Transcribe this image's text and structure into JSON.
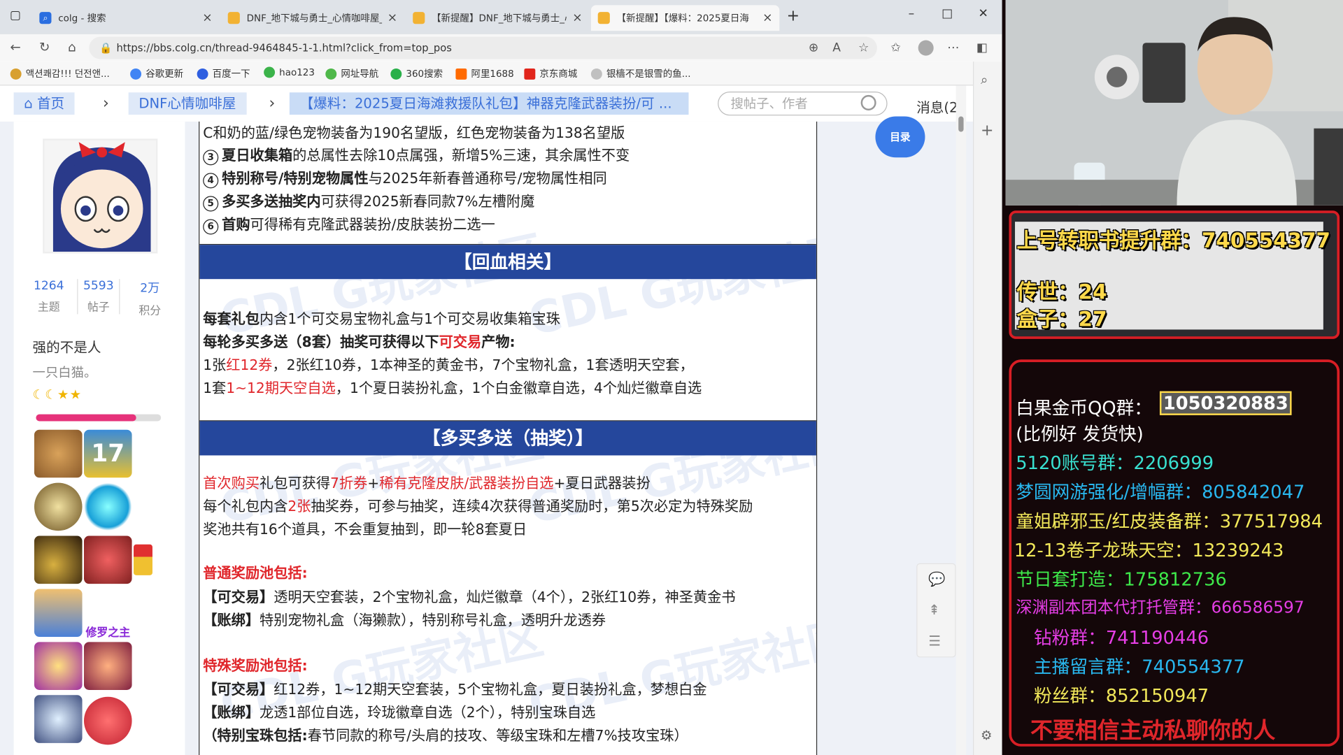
{
  "browser": {
    "tabs": [
      {
        "label": "colg - 搜索",
        "icon": "search-icon"
      },
      {
        "label": "DNF_地下城与勇士_心情咖啡屋_",
        "icon": "colg-favicon"
      },
      {
        "label": "【新提醒】DNF_地下城与勇士_心",
        "icon": "colg-favicon"
      },
      {
        "label": "【新提醒】【爆料：2025夏日海",
        "icon": "colg-favicon"
      }
    ],
    "url": "https://bbs.colg.cn/thread-9464845-1-1.html?click_from=top_pos",
    "bookmarks": [
      "액션쾌감!!! 던전앤...",
      "谷歌更新",
      "百度一下",
      "hao123",
      "网址导航",
      "360搜索",
      "阿里1688",
      "京东商城",
      "银樯不是银雪的鱼..."
    ]
  },
  "forum": {
    "crumbs": [
      "首页",
      "DNF心情咖啡屋",
      "【爆料：2025夏日海滩救援队礼包】神器克隆武器装扮/可 ..."
    ],
    "search_placeholder": "搜帖子、作者",
    "messages": "消息(2",
    "toc": "目录",
    "user": {
      "stats": [
        {
          "num": "1264",
          "label": "主题"
        },
        {
          "num": "5593",
          "label": "帖子"
        },
        {
          "num": "2万",
          "label": "积分"
        }
      ],
      "name": "强的不是人",
      "sign": "一只白猫。",
      "medal_text": "修罗之主",
      "progress": 0.8
    },
    "post": {
      "l1": "C和奶的蓝/绿色宠物装备为190名望版，红色宠物装备为138名望版",
      "l2n": "3",
      "l2a": "夏日收集箱",
      "l2b": "的总属性去除10点属强，新增5%三速，其余属性不变",
      "l3n": "4",
      "l3a": "特别称号/特别宠物属性",
      "l3b": "与2025年新春普通称号/宠物属性相同",
      "l4n": "5",
      "l4a": "多买多送抽奖内",
      "l4b": "可获得2025新春同款7%左槽附魔",
      "l5n": "6",
      "l5a": "首购",
      "l5b": "可得稀有克隆武器装扮/皮肤装扮二选一",
      "banner1": "【回血相关】",
      "p1a": "每套礼包",
      "p1b": "内含1个可交易宝物礼盒与1个可交易收集箱宝珠",
      "p2a": "每轮多买多送（8套）抽奖可获得以下",
      "p2b": "可交易",
      "p2c": "产物:",
      "p3a": "1张",
      "p3b": "红12券",
      "p3c": "，2张红10券，1本神圣的黄金书，7个宝物礼盒，1套透明天空套，",
      "p4a": "1套",
      "p4b": "1~12期天空自选",
      "p4c": "，1个夏日装扮礼盒，1个白金徽章自选，4个灿烂徽章自选",
      "banner2": "【多买多送（抽奖）】",
      "q1a": "首次购买",
      "q1b": "礼包可获得",
      "q1c": "7折券",
      "q1d": "+",
      "q1e": "稀有克隆皮肤/武器装扮自选",
      "q1f": "+夏日武器装扮",
      "q2a": "每个礼包内含",
      "q2b": "2张",
      "q2c": "抽奖券，可参与抽奖，连续4次获得普通奖励时，第5次必定为特殊奖励",
      "q3": "奖池共有16个道具，不会重复抽到，即一轮8套夏日",
      "q4": "普通奖励池包括:",
      "q5a": "【可交易】",
      "q5b": "透明天空套装，2个宝物礼盒，灿烂徽章（4个），2张红10券，神圣黄金书",
      "q6a": "【账绑】",
      "q6b": "特别宠物礼盒（海獭款），特别称号礼盒，透明升龙透券",
      "q7": "特殊奖励池包括:",
      "q8a": "【可交易】",
      "q8b": "红12券，1~12期天空套装，5个宝物礼盒，夏日装扮礼盒，梦想白金",
      "q9a": "【账绑】",
      "q9b": "龙透1部位自选，玲珑徽章自选（2个），特别宝珠自选",
      "q10a": "（特别宝珠包括:",
      "q10b": "春节同款的称号/头肩的技攻、等级宝珠和左槽7%技攻宝珠）"
    }
  },
  "overlay": {
    "box1": [
      "上号转职书提升群：740554377",
      "传世：24",
      "盒子：27"
    ],
    "gold_label": "白果金币QQ群：",
    "gold_number": "1050320883",
    "gold_note": "(比例好 发货快)",
    "groups": [
      {
        "text": "5120账号群：2206999",
        "color": "#39e0d0"
      },
      {
        "text": "梦圆网游强化/增幅群：805842047",
        "color": "#29b8f0"
      },
      {
        "text": "童姐辟邪玉/红皮装备群：377517984",
        "color": "#f2e85a"
      },
      {
        "text": "12-13卷子龙珠天空：13239243",
        "color": "#f2e85a"
      },
      {
        "text": "节日套打造：175812736",
        "color": "#3ee84a"
      },
      {
        "text": "深渊副本团本代打托管群：666586597",
        "color": "#e63ee6"
      },
      {
        "text": "钻粉群：741190446",
        "color": "#e63ee6"
      },
      {
        "text": "主播留言群：740554377",
        "color": "#29b8f0"
      },
      {
        "text": "粉丝群：852150947",
        "color": "#f2e85a"
      }
    ],
    "warning": "不要相信主动私聊你的人"
  },
  "colors": {
    "banner": "#25479c",
    "red": "#e0262b",
    "link": "#3a6fd8",
    "overlay_red": "#d81e25"
  }
}
